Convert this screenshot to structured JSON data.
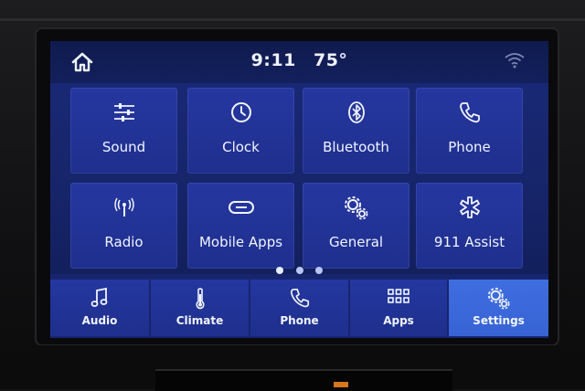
{
  "status_bar": {
    "time": "9:11",
    "temperature": "75°",
    "home_icon": "home-icon",
    "wifi_icon": "wifi-icon"
  },
  "tiles": [
    {
      "label": "Sound",
      "icon": "sliders-icon"
    },
    {
      "label": "Clock",
      "icon": "clock-icon"
    },
    {
      "label": "Bluetooth",
      "icon": "bluetooth-icon"
    },
    {
      "label": "Phone",
      "icon": "phone-icon"
    },
    {
      "label": "Radio",
      "icon": "radio-antenna-icon"
    },
    {
      "label": "Mobile Apps",
      "icon": "mobile-apps-icon"
    },
    {
      "label": "General",
      "icon": "gears-icon"
    },
    {
      "label": "911 Assist",
      "icon": "star-of-life-icon"
    }
  ],
  "pager": {
    "pages": 3,
    "current": 1
  },
  "bottom_nav": [
    {
      "label": "Audio",
      "icon": "music-note-icon",
      "active": false
    },
    {
      "label": "Climate",
      "icon": "thermometer-icon",
      "active": false
    },
    {
      "label": "Phone",
      "icon": "phone-icon",
      "active": false
    },
    {
      "label": "Apps",
      "icon": "grid-icon",
      "active": false
    },
    {
      "label": "Settings",
      "icon": "gears-icon",
      "active": true
    }
  ],
  "colors": {
    "screen_bg": "#1a2a78",
    "tile_bg": "#2537a0",
    "active_nav": "#3f6ee0",
    "text": "#f2f4ff"
  }
}
